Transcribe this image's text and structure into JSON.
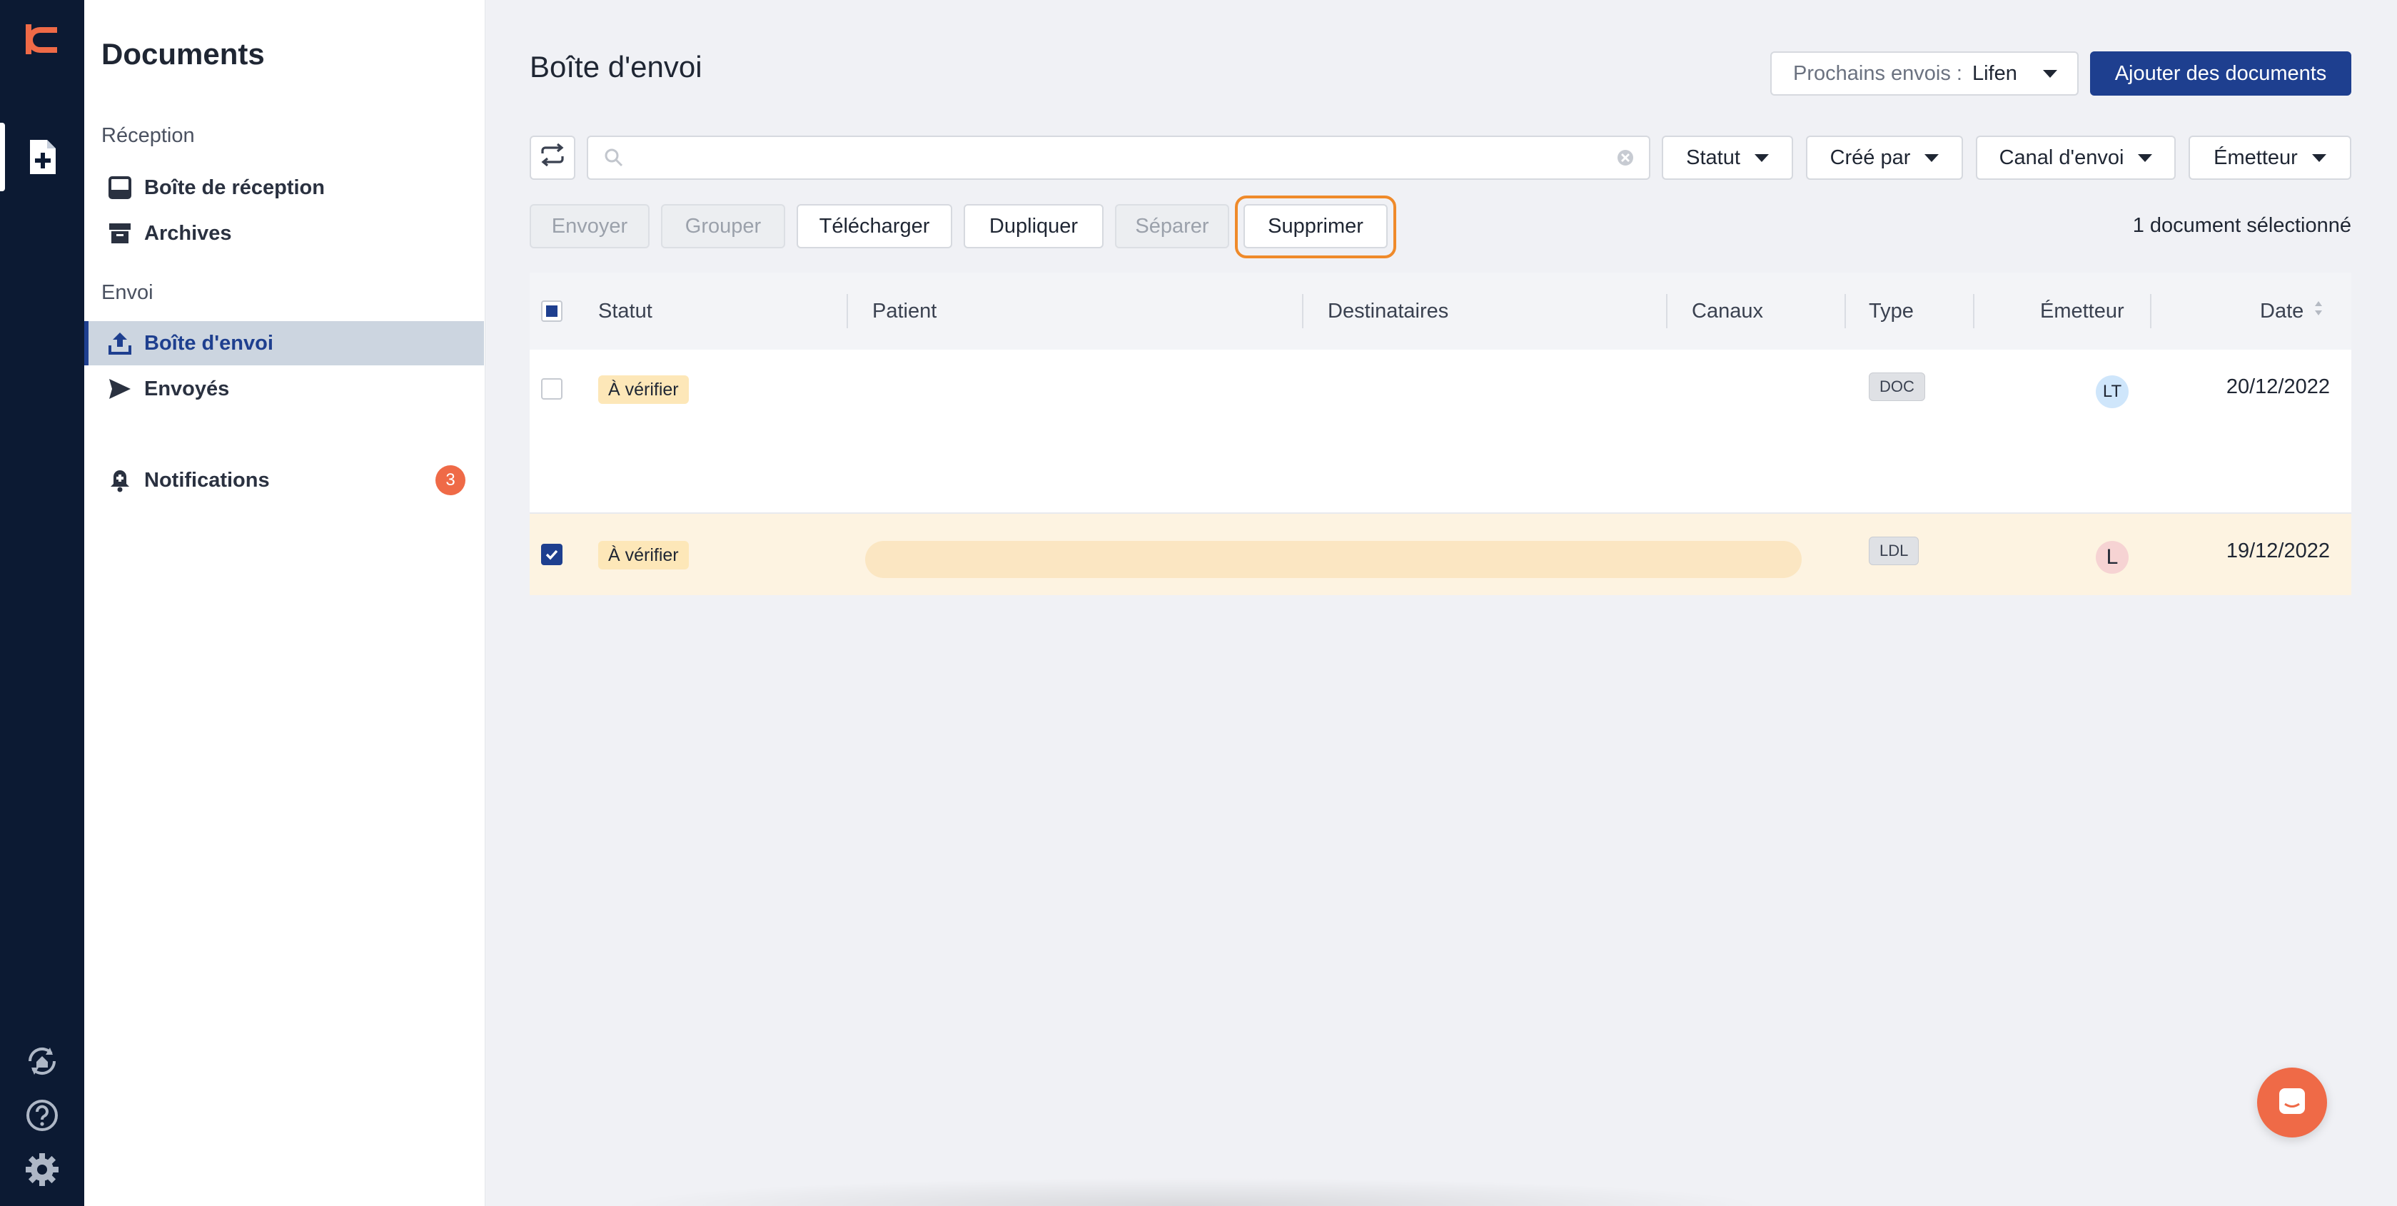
{
  "sidebar": {
    "title": "Documents",
    "reception_label": "Réception",
    "envoi_label": "Envoi",
    "items": {
      "inbox": "Boîte de réception",
      "archives": "Archives",
      "outbox": "Boîte d'envoi",
      "sent": "Envoyés",
      "notifications": "Notifications"
    },
    "notifications_count": "3"
  },
  "header": {
    "title": "Boîte d'envoi",
    "next_sends_label": "Prochains envois :",
    "next_sends_value": "Lifen",
    "add_button": "Ajouter des documents"
  },
  "search": {
    "placeholder": ""
  },
  "filters": {
    "status": "Statut",
    "created_by": "Créé par",
    "channel": "Canal d'envoi",
    "sender": "Émetteur"
  },
  "actions": {
    "send": "Envoyer",
    "group": "Grouper",
    "download": "Télécharger",
    "duplicate": "Dupliquer",
    "separate": "Séparer",
    "delete": "Supprimer",
    "selection_count": "1 document sélectionné"
  },
  "table": {
    "columns": {
      "status": "Statut",
      "patient": "Patient",
      "recipients": "Destinataires",
      "channels": "Canaux",
      "type": "Type",
      "sender": "Émetteur",
      "date": "Date"
    },
    "rows": [
      {
        "selected": false,
        "status": "À vérifier",
        "type": "DOC",
        "sender": "LT",
        "sender_color": "#cfe6fb",
        "date": "20/12/2022"
      },
      {
        "selected": true,
        "status": "À vérifier",
        "type": "LDL",
        "sender": "L",
        "sender_color": "#f6d3d3",
        "date": "19/12/2022"
      }
    ]
  },
  "colors": {
    "rail": "#0c1a33",
    "primary": "#1e3f8f",
    "accent": "#ef6a47",
    "focus": "#ef8a2a",
    "selected_row": "#fdf3e1"
  }
}
